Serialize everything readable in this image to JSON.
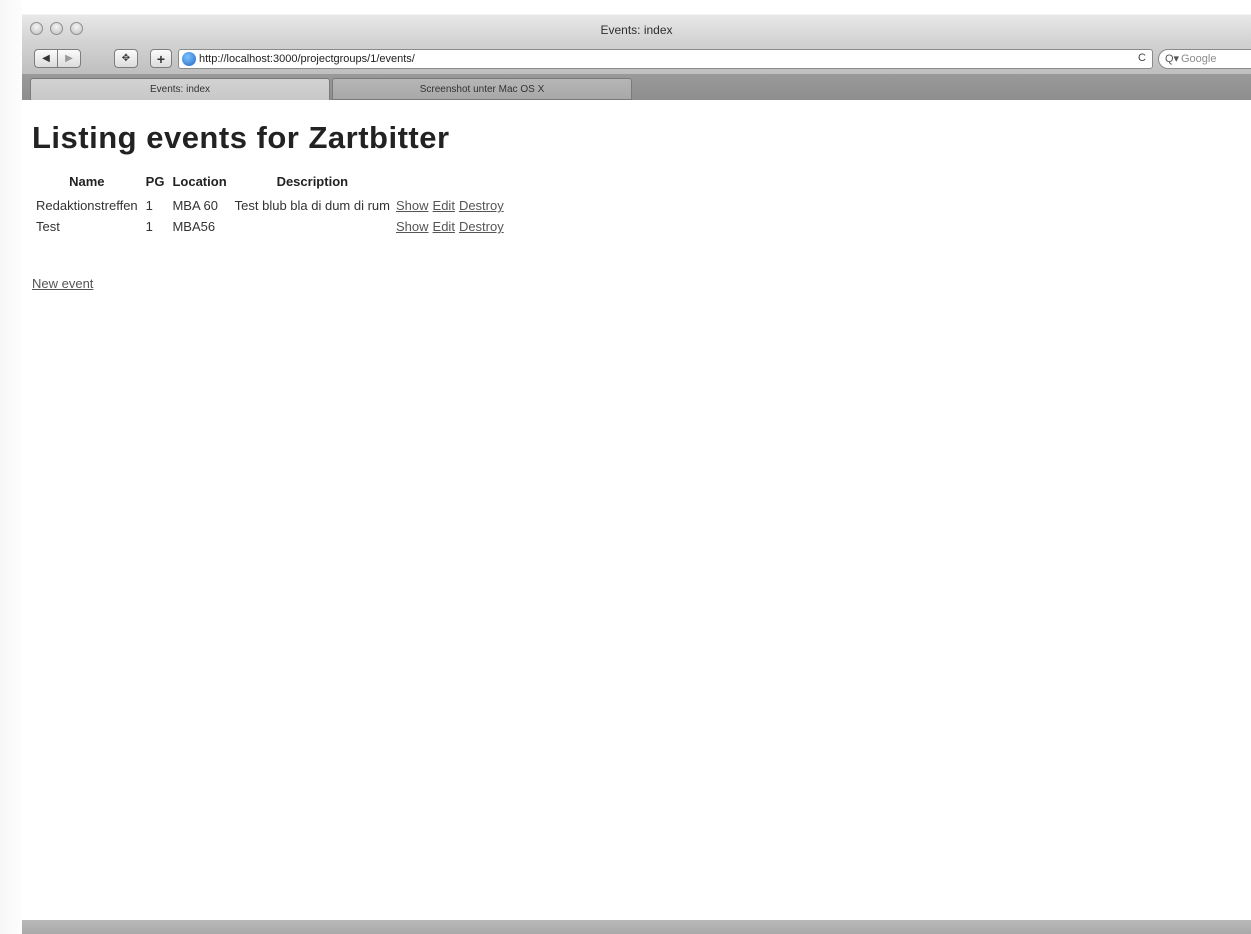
{
  "window": {
    "title": "Events: index"
  },
  "toolbar": {
    "back_label": "◀",
    "forward_label": "▶",
    "reload_label": "✥",
    "add_label": "+",
    "url": "http://localhost:3000/projectgroups/1/events/",
    "refresh_label": "C",
    "search_icon": "Q▾",
    "search_placeholder": "Google"
  },
  "tabs": [
    {
      "label": "Events: index",
      "active": true
    },
    {
      "label": "Screenshot unter Mac OS X",
      "active": false
    }
  ],
  "page": {
    "heading": "Listing events for Zartbitter",
    "columns": [
      "Name",
      "PG",
      "Location",
      "Description"
    ],
    "rows": [
      {
        "name": "Redaktionstreffen",
        "pg": "1",
        "location": "MBA 60",
        "description": "Test blub bla di dum di rum",
        "show": "Show",
        "edit": "Edit",
        "destroy": "Destroy"
      },
      {
        "name": "Test",
        "pg": "1",
        "location": "MBA56",
        "description": "",
        "show": "Show",
        "edit": "Edit",
        "destroy": "Destroy"
      }
    ],
    "new_event_label": "New event"
  }
}
